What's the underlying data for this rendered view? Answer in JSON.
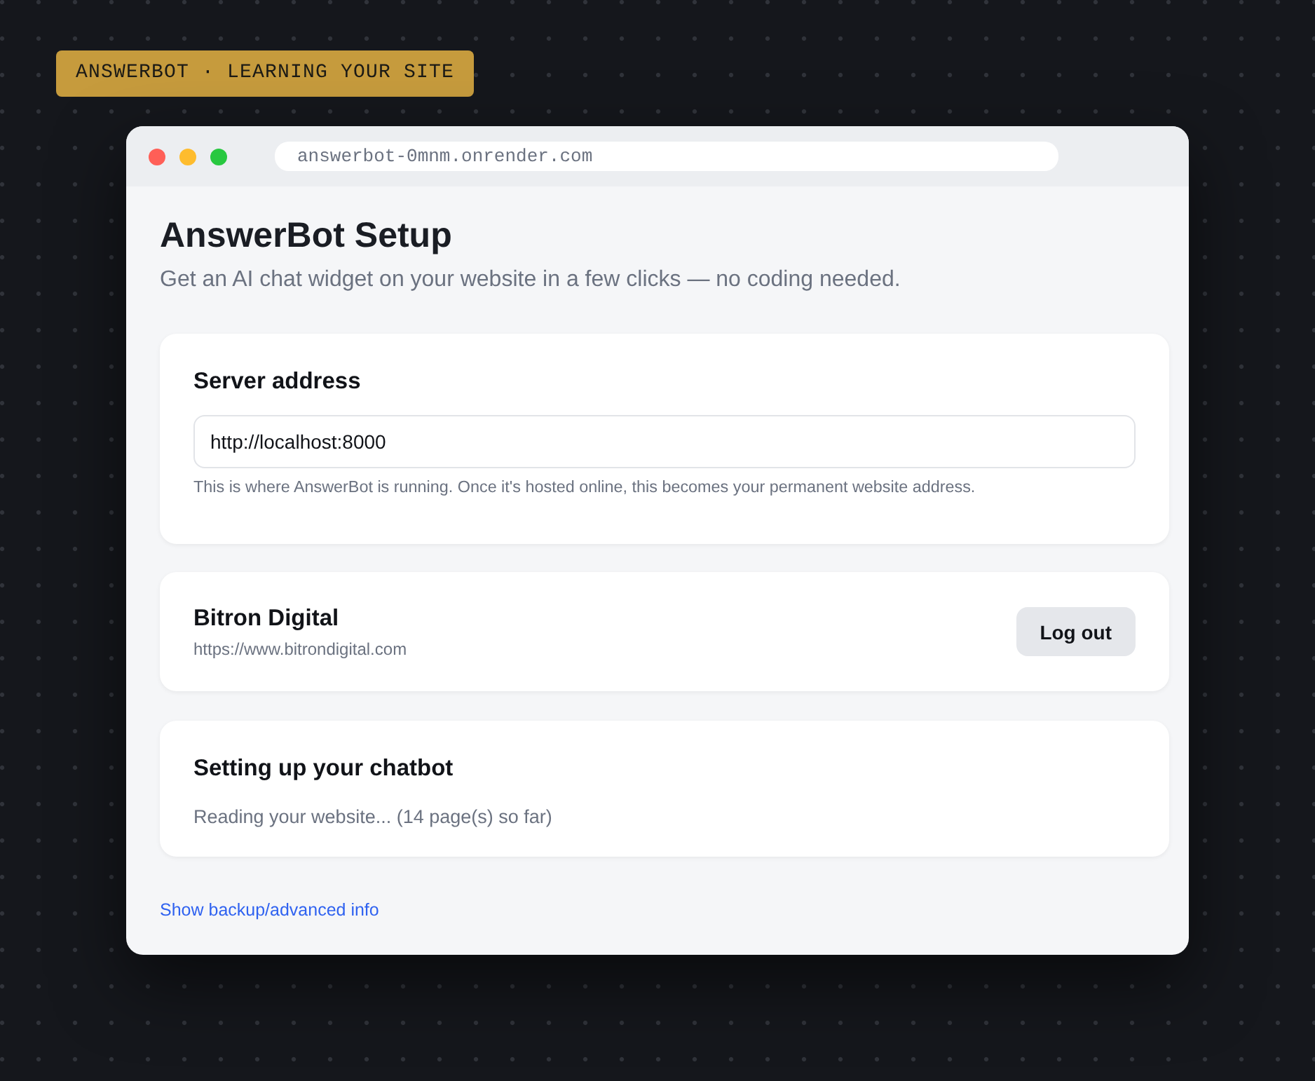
{
  "badge": {
    "text": "ANSWERBOT · LEARNING YOUR SITE"
  },
  "browser": {
    "address": "answerbot-0mnm.onrender.com"
  },
  "page": {
    "title": "AnswerBot Setup",
    "subtitle": "Get an AI chat widget on your website in a few clicks — no coding needed."
  },
  "server_card": {
    "title": "Server address",
    "field_value": "http://localhost:8000",
    "hint": "This is where AnswerBot is running. Once it's hosted online, this becomes your permanent website address."
  },
  "account_card": {
    "name": "Bitron Digital",
    "url": "https://www.bitrondigital.com",
    "button": "Log out"
  },
  "status_card": {
    "title": "Setting up your chatbot",
    "message": "Reading your website... (14 page(s) so far)"
  },
  "footer_link": "Show backup/advanced info"
}
